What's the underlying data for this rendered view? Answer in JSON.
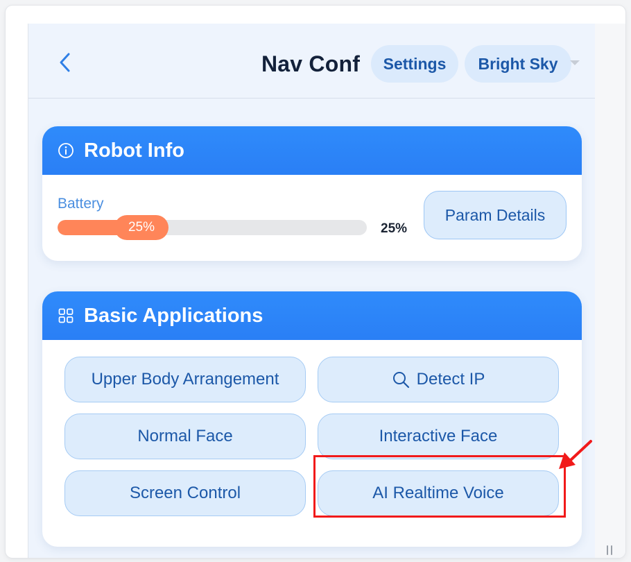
{
  "header": {
    "title": "Nav Conf",
    "settings_label": "Settings",
    "theme_label": "Bright Sky"
  },
  "robot_info": {
    "title": "Robot Info",
    "battery_label": "Battery",
    "battery_percent": 25,
    "battery_bubble_text": "25%",
    "battery_value_text": "25%",
    "param_details_label": "Param Details",
    "colors": {
      "battery_fill": "#ff8559"
    }
  },
  "apps": {
    "title": "Basic Applications",
    "buttons": [
      {
        "label": "Upper Body Arrangement"
      },
      {
        "label": "Detect IP",
        "icon": "search-icon"
      },
      {
        "label": "Normal Face"
      },
      {
        "label": "Interactive Face"
      },
      {
        "label": "Screen Control"
      },
      {
        "label": "AI Realtime Voice",
        "highlighted": true
      }
    ]
  },
  "colors": {
    "accent": "#2f8bfb",
    "button_bg": "#ddecfc",
    "button_text": "#1c58a8",
    "annotation": "#f11a1a"
  }
}
